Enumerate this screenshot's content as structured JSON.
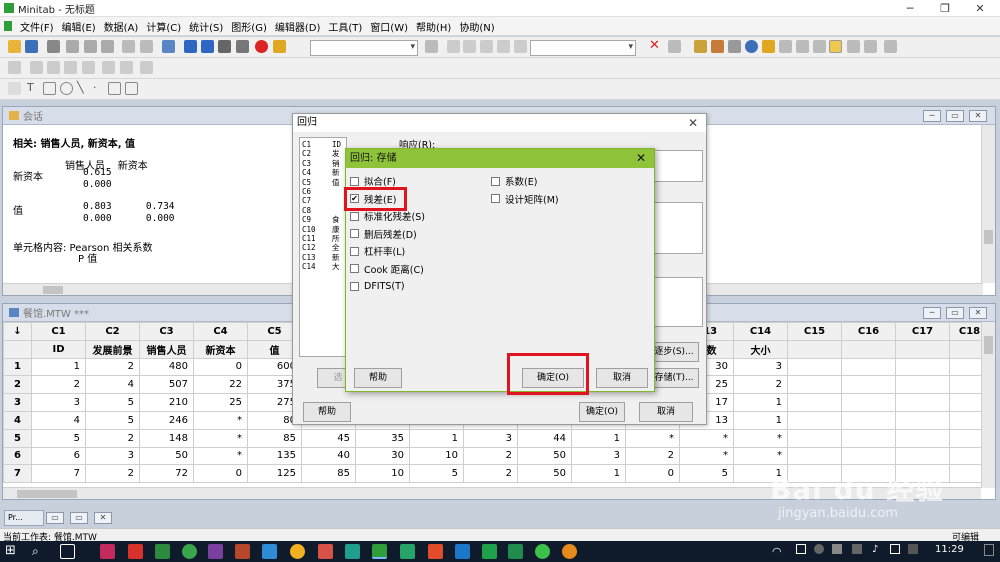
{
  "window": {
    "title": "Minitab - 无标题"
  },
  "menu": [
    "文件(F)",
    "编辑(E)",
    "数据(A)",
    "计算(C)",
    "统计(S)",
    "图形(G)",
    "编辑器(D)",
    "工具(T)",
    "窗口(W)",
    "帮助(H)",
    "协助(N)"
  ],
  "session": {
    "title": "会话",
    "heading": "相关: 销售人员, 新资本, 值",
    "col_headers": "销售人员    新资本",
    "row1_label": "新资本",
    "row1_vals": "0.615",
    "row1_p": "0.000",
    "row2_label": "值",
    "row2_vals": "0.803      0.734",
    "row2_p": "0.000      0.000",
    "footer1": "单元格内容: Pearson 相关系数",
    "footer2": "P 值"
  },
  "worksheet": {
    "title": "餐馆.MTW ***",
    "columns": [
      "C1",
      "C2",
      "C3",
      "C4",
      "C5",
      "C6",
      "C7",
      "C8",
      "C9",
      "C10",
      "C11",
      "C12",
      "C13",
      "C14",
      "C15",
      "C16",
      "C17",
      "C18"
    ],
    "names": [
      "ID",
      "发展前景",
      "销售人员",
      "新资本",
      "值",
      "",
      "",
      "",
      "",
      "",
      "",
      "",
      "工数",
      "大小",
      "",
      "",
      "",
      ""
    ],
    "rows": [
      {
        "n": "1",
        "cells": [
          "1",
          "2",
          "480",
          "0",
          "600",
          "",
          "",
          "",
          "",
          "",
          "",
          "",
          "30",
          "3",
          "",
          "",
          "",
          ""
        ]
      },
      {
        "n": "2",
        "cells": [
          "2",
          "4",
          "507",
          "22",
          "375",
          "",
          "",
          "",
          "",
          "",
          "",
          "",
          "25",
          "2",
          "",
          "",
          "",
          ""
        ]
      },
      {
        "n": "3",
        "cells": [
          "3",
          "5",
          "210",
          "25",
          "275",
          "",
          "",
          "",
          "",
          "",
          "",
          "",
          "17",
          "1",
          "",
          "",
          "",
          ""
        ]
      },
      {
        "n": "4",
        "cells": [
          "4",
          "5",
          "246",
          "*",
          "80",
          "",
          "",
          "",
          "",
          "",
          "",
          "",
          "13",
          "1",
          "",
          "",
          "",
          ""
        ]
      },
      {
        "n": "5",
        "cells": [
          "5",
          "2",
          "148",
          "*",
          "85",
          "45",
          "35",
          "1",
          "3",
          "44",
          "1",
          "*",
          "*",
          "*",
          "",
          "",
          "",
          ""
        ]
      },
      {
        "n": "6",
        "cells": [
          "6",
          "3",
          "50",
          "*",
          "135",
          "40",
          "30",
          "10",
          "2",
          "50",
          "3",
          "2",
          "*",
          "*",
          "",
          "",
          "",
          ""
        ]
      },
      {
        "n": "7",
        "cells": [
          "7",
          "2",
          "72",
          "0",
          "125",
          "85",
          "10",
          "5",
          "2",
          "50",
          "1",
          "0",
          "5",
          "1",
          "",
          "",
          "",
          ""
        ]
      }
    ]
  },
  "regression_dialog": {
    "title": "回归",
    "response_label": "响应(R):",
    "columns": [
      "C1",
      "C2",
      "C3",
      "C4",
      "C5",
      "C6",
      "C7",
      "C8",
      "C9",
      "C10",
      "C11",
      "C12",
      "C13",
      "C14"
    ],
    "columns_names": [
      "ID",
      "发",
      "销",
      "新",
      "值",
      "",
      "",
      "",
      "食",
      "康",
      "所",
      "全",
      "新",
      "大"
    ],
    "stepwise_label": "逐步(S)...",
    "storage_label": "存储(T)...",
    "select_label": "选",
    "help_label": "帮助",
    "ok_label": "确定(O)",
    "cancel_label": "取消"
  },
  "storage_dialog": {
    "title": "回归: 存储",
    "options_left": [
      "拟合(F)",
      "残差(E)",
      "标准化残差(S)",
      "删后残差(D)",
      "杠杆率(L)",
      "Cook 距离(C)",
      "DFITS(T)"
    ],
    "options_right": [
      "系数(E)",
      "设计矩阵(M)"
    ],
    "checked": "残差(E)",
    "help_label": "帮助",
    "ok_label": "确定(O)",
    "cancel_label": "取消"
  },
  "status": {
    "current_sheet": "当前工作表: 餐馆.MTW",
    "mode": "可编辑"
  },
  "taskbar": {
    "time": "11:29"
  },
  "watermark": {
    "brand": "Bai du 经验",
    "url": "jingyan.baidu.com"
  },
  "mdi_tab": "Pr..."
}
